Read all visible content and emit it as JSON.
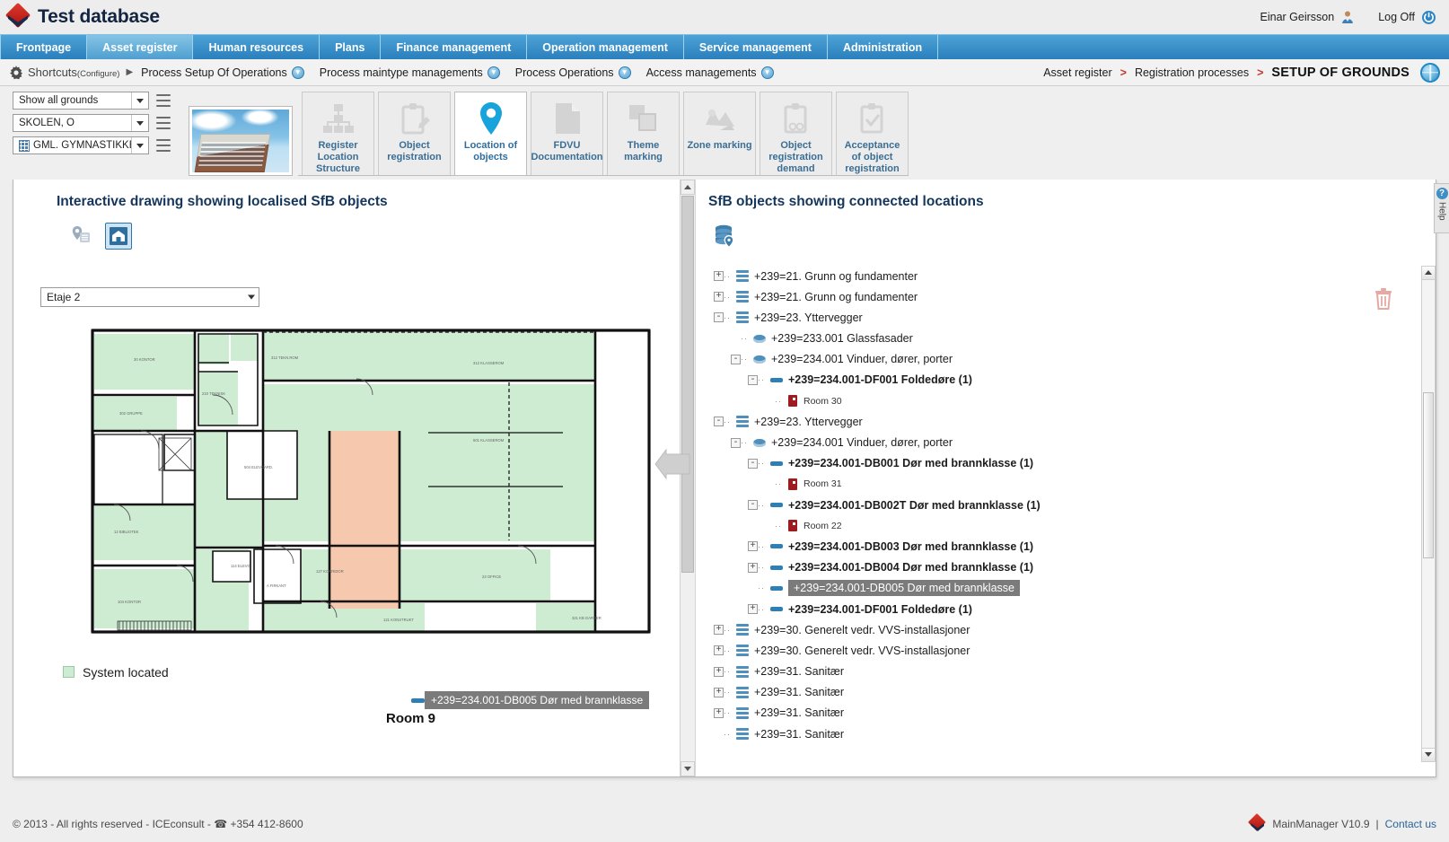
{
  "app": {
    "title": "Test database",
    "user": "Einar Geirsson",
    "logoff": "Log Off"
  },
  "mainnav": [
    {
      "label": "Frontpage",
      "active": false
    },
    {
      "label": "Asset register",
      "active": true
    },
    {
      "label": "Human resources",
      "active": false
    },
    {
      "label": "Plans",
      "active": false
    },
    {
      "label": "Finance management",
      "active": false
    },
    {
      "label": "Operation management",
      "active": false
    },
    {
      "label": "Service management",
      "active": false
    },
    {
      "label": "Administration",
      "active": false
    }
  ],
  "shortcuts": {
    "label": "Shortcuts",
    "configure": "(Configure)",
    "items": [
      {
        "label": "Process Setup Of Operations"
      },
      {
        "label": "Process maintype managements"
      },
      {
        "label": "Process Operations"
      },
      {
        "label": "Access managements"
      }
    ]
  },
  "breadcrumb": {
    "items": [
      "Asset register",
      "Registration processes"
    ],
    "separator": ">",
    "current": "SETUP OF GROUNDS"
  },
  "selectors": [
    {
      "value": "Show all grounds",
      "icon": false
    },
    {
      "value": "SKOLEN, O",
      "icon": false
    },
    {
      "value": "GML. GYMNASTIKKBY",
      "icon": true
    }
  ],
  "toolbar": {
    "buttons": [
      {
        "label": "Register Location Structure",
        "icon": "org-chart-icon",
        "active": false
      },
      {
        "label": "Object registration",
        "icon": "clipboard-pencil-icon",
        "active": false
      },
      {
        "label": "Location of objects",
        "icon": "map-pin-icon",
        "active": true
      },
      {
        "label": "FDVU Documentation",
        "icon": "document-icon",
        "active": false
      },
      {
        "label": "Theme marking",
        "icon": "squares-icon",
        "active": false
      },
      {
        "label": "Zone marking",
        "icon": "zone-icon",
        "active": false
      },
      {
        "label": "Object registration demand",
        "icon": "clipboard-gears-icon",
        "active": false
      },
      {
        "label": "Acceptance of object registration",
        "icon": "clipboard-check-icon",
        "active": false
      }
    ]
  },
  "left_panel": {
    "title": "Interactive drawing showing localised SfB objects",
    "tools": [
      {
        "name": "pin-list-icon",
        "active": false
      },
      {
        "name": "drawing-icon",
        "active": true
      }
    ],
    "floor_select": "Etaje 2",
    "tooltip": "+239=234.001-DB005 Dør med brannklasse",
    "room_label": "Room 9",
    "legend": {
      "label": "System located",
      "color": "#cdecd2"
    }
  },
  "right_panel": {
    "title": "SfB objects showing connected locations",
    "tools": [
      {
        "name": "database-location-icon",
        "active": false
      }
    ],
    "delete_icon": "trash-icon",
    "tree": [
      {
        "depth": 0,
        "expander": "+",
        "icon": "stack",
        "label": "+239=21. Grunn og fundamenter",
        "bold": false,
        "small": false,
        "selected": false
      },
      {
        "depth": 0,
        "expander": "+",
        "icon": "stack",
        "label": "+239=21. Grunn og fundamenter",
        "bold": false,
        "small": false,
        "selected": false
      },
      {
        "depth": 0,
        "expander": "-",
        "icon": "stack",
        "label": "+239=23. Yttervegger",
        "bold": false,
        "small": false,
        "selected": false
      },
      {
        "depth": 1,
        "expander": "",
        "icon": "disc",
        "label": "+239=233.001 Glassfasader",
        "bold": false,
        "small": false,
        "selected": false
      },
      {
        "depth": 1,
        "expander": "-",
        "icon": "disc",
        "label": "+239=234.001 Vinduer, dører, porter",
        "bold": false,
        "small": false,
        "selected": false
      },
      {
        "depth": 2,
        "expander": "-",
        "icon": "bar",
        "label": "+239=234.001-DF001 Foldedøre (1)",
        "bold": true,
        "small": false,
        "selected": false
      },
      {
        "depth": 3,
        "expander": "",
        "icon": "door",
        "label": "Room 30",
        "bold": false,
        "small": true,
        "selected": false
      },
      {
        "depth": 0,
        "expander": "-",
        "icon": "stack",
        "label": "+239=23. Yttervegger",
        "bold": false,
        "small": false,
        "selected": false
      },
      {
        "depth": 1,
        "expander": "-",
        "icon": "disc",
        "label": "+239=234.001 Vinduer, dører, porter",
        "bold": false,
        "small": false,
        "selected": false
      },
      {
        "depth": 2,
        "expander": "-",
        "icon": "bar",
        "label": "+239=234.001-DB001 Dør med brannklasse (1)",
        "bold": true,
        "small": false,
        "selected": false
      },
      {
        "depth": 3,
        "expander": "",
        "icon": "door",
        "label": "Room 31",
        "bold": false,
        "small": true,
        "selected": false
      },
      {
        "depth": 2,
        "expander": "-",
        "icon": "bar",
        "label": "+239=234.001-DB002T Dør med brannklasse (1)",
        "bold": true,
        "small": false,
        "selected": false
      },
      {
        "depth": 3,
        "expander": "",
        "icon": "door",
        "label": "Room 22",
        "bold": false,
        "small": true,
        "selected": false
      },
      {
        "depth": 2,
        "expander": "+",
        "icon": "bar",
        "label": "+239=234.001-DB003 Dør med brannklasse (1)",
        "bold": true,
        "small": false,
        "selected": false
      },
      {
        "depth": 2,
        "expander": "+",
        "icon": "bar",
        "label": "+239=234.001-DB004 Dør med brannklasse (1)",
        "bold": true,
        "small": false,
        "selected": false
      },
      {
        "depth": 2,
        "expander": "",
        "icon": "bar",
        "label": "+239=234.001-DB005 Dør med brannklasse",
        "bold": false,
        "small": false,
        "selected": true
      },
      {
        "depth": 2,
        "expander": "+",
        "icon": "bar",
        "label": "+239=234.001-DF001 Foldedøre (1)",
        "bold": true,
        "small": false,
        "selected": false
      },
      {
        "depth": 0,
        "expander": "+",
        "icon": "stack",
        "label": "+239=30. Generelt vedr. VVS-installasjoner",
        "bold": false,
        "small": false,
        "selected": false
      },
      {
        "depth": 0,
        "expander": "+",
        "icon": "stack",
        "label": "+239=30. Generelt vedr. VVS-installasjoner",
        "bold": false,
        "small": false,
        "selected": false
      },
      {
        "depth": 0,
        "expander": "+",
        "icon": "stack",
        "label": "+239=31. Sanitær",
        "bold": false,
        "small": false,
        "selected": false
      },
      {
        "depth": 0,
        "expander": "+",
        "icon": "stack",
        "label": "+239=31. Sanitær",
        "bold": false,
        "small": false,
        "selected": false
      },
      {
        "depth": 0,
        "expander": "+",
        "icon": "stack",
        "label": "+239=31. Sanitær",
        "bold": false,
        "small": false,
        "selected": false
      },
      {
        "depth": 0,
        "expander": "",
        "icon": "stack",
        "label": "+239=31. Sanitær",
        "bold": false,
        "small": false,
        "selected": false
      }
    ]
  },
  "help": {
    "label": "Help",
    "icon": "question-icon"
  },
  "footer": {
    "left": "© 2013 - All rights reserved - ICEconsult - ☎ +354 412-8600",
    "product": "MainManager V10.9",
    "divider": "|",
    "contact": "Contact us"
  },
  "colors": {
    "accent": "#2a7fbd",
    "brand_red": "#c0392b",
    "title_blue": "#15365c",
    "room_fill": "#f6c9ae",
    "system_located": "#cdecd2"
  }
}
